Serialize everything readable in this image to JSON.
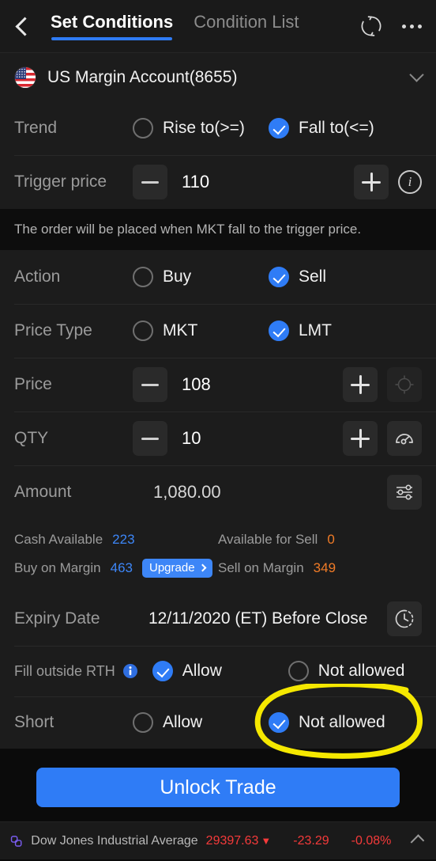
{
  "header": {
    "back_icon": "back-chevron-icon",
    "tabs": [
      {
        "label": "Set Conditions",
        "active": true
      },
      {
        "label": "Condition List",
        "active": false
      }
    ],
    "refresh_icon": "refresh-icon",
    "more_icon": "more-dots-icon"
  },
  "account": {
    "flag_icon": "us-flag-icon",
    "name": "US Margin Account(8655)",
    "chevron_icon": "chevron-down-icon"
  },
  "trend": {
    "label": "Trend",
    "options": [
      {
        "label": "Rise to(>=)",
        "selected": false
      },
      {
        "label": "Fall to(<=)",
        "selected": true
      }
    ]
  },
  "trigger_price": {
    "label": "Trigger price",
    "value": "110",
    "minus_icon": "minus-icon",
    "plus_icon": "plus-icon",
    "info_icon": "info-icon"
  },
  "hint": "The order will be placed when MKT fall to the trigger price.",
  "action": {
    "label": "Action",
    "options": [
      {
        "label": "Buy",
        "selected": false
      },
      {
        "label": "Sell",
        "selected": true
      }
    ]
  },
  "price_type": {
    "label": "Price Type",
    "options": [
      {
        "label": "MKT",
        "selected": false
      },
      {
        "label": "LMT",
        "selected": true
      }
    ]
  },
  "price": {
    "label": "Price",
    "value": "108",
    "minus_icon": "minus-icon",
    "plus_icon": "plus-icon",
    "target_icon": "crosshair-target-icon"
  },
  "qty": {
    "label": "QTY",
    "value": "10",
    "minus_icon": "minus-icon",
    "plus_icon": "plus-icon",
    "gauge_icon": "gauge-icon"
  },
  "amount": {
    "label": "Amount",
    "value": "1,080.00",
    "sliders_icon": "sliders-icon"
  },
  "balances": {
    "cash_available_label": "Cash Available",
    "cash_available_value": "223",
    "available_for_sell_label": "Available for Sell",
    "available_for_sell_value": "0",
    "buy_on_margin_label": "Buy on Margin",
    "buy_on_margin_value": "463",
    "upgrade_label": "Upgrade",
    "sell_on_margin_label": "Sell on Margin",
    "sell_on_margin_value": "349"
  },
  "expiry": {
    "label": "Expiry Date",
    "value": "12/11/2020 (ET) Before Close",
    "clock_icon": "clock-history-icon"
  },
  "fill_outside_rth": {
    "label": "Fill outside RTH",
    "info_icon": "info-filled-icon",
    "options": [
      {
        "label": "Allow",
        "selected": true
      },
      {
        "label": "Not allowed",
        "selected": false
      }
    ]
  },
  "short": {
    "label": "Short",
    "options": [
      {
        "label": "Allow",
        "selected": false
      },
      {
        "label": "Not allowed",
        "selected": true
      }
    ]
  },
  "cta": {
    "label": "Unlock Trade"
  },
  "ticker": {
    "link_icon": "link-icon",
    "name": "Dow Jones Industrial Average",
    "price": "29397.63",
    "arrow": "▼",
    "change": "-23.29",
    "percent": "-0.08%",
    "collapse_icon": "chevron-up-icon"
  },
  "colors": {
    "accent": "#2f7cf6",
    "positive_blue": "#3d86f7",
    "orange": "#f07b27",
    "down_red": "#f53a3a",
    "annotation_yellow": "#f5e800",
    "row_bg": "#1c1c1c",
    "page_bg": "#0b0b0b"
  }
}
